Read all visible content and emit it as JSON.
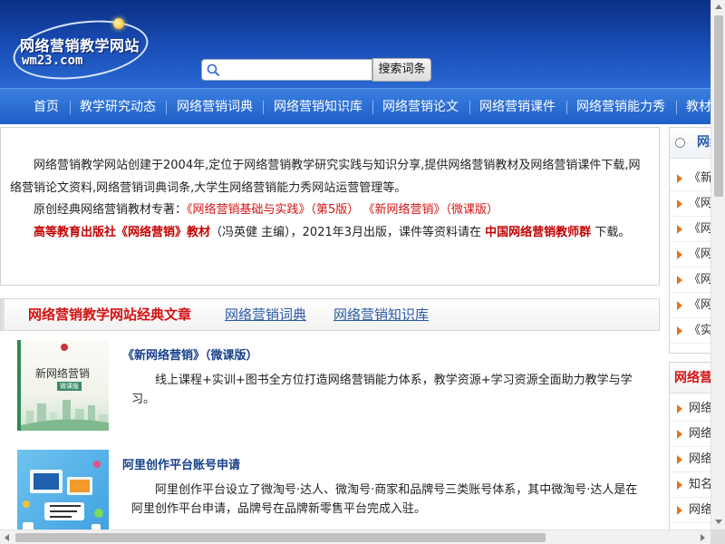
{
  "header": {
    "logo_cn": "网络营销教学网站",
    "logo_en": "wm23.com",
    "search_placeholder": "",
    "search_button": "搜索词条"
  },
  "nav": {
    "items": [
      {
        "label": "首页"
      },
      {
        "label": "教学研究动态"
      },
      {
        "label": "网络营销词典"
      },
      {
        "label": "网络营销知识库"
      },
      {
        "label": "网络营销论文"
      },
      {
        "label": "网络营销课件"
      },
      {
        "label": "网络营销能力秀"
      },
      {
        "label": "教材"
      }
    ]
  },
  "intro": {
    "p1": "网络营销教学网站创建于2004年,定位于网络营销教学研究实践与知识分享,提供网络营销教材及网络营销课件下载,网络营销论文资料,网络营销词典词条,大学生网络营销能力秀网站运营管理等。",
    "p2_prefix": "原创经典网络营销教材专著：",
    "p2_book1": "《网络营销基础与实践》（第5版）",
    "p2_book2": "《新网络营销》（微课版）",
    "p3_publisher": "高等教育出版社《网络营销》教材",
    "p3_mid": "（冯英健 主编），2021年3月出版，课件等资料请在",
    "p3_group": "中国网络营销教师群",
    "p3_end": "下载。"
  },
  "section": {
    "title": "网络营销教学网站经典文章",
    "link1": "网络营销词典",
    "link2": "网络营销知识库"
  },
  "articles": [
    {
      "title": "《新网络营销》（微课版）",
      "desc": "线上课程+实训+图书全方位打造网络营销能力体系，教学资源+学习资源全面助力教学与学习。",
      "thumb_title": "新网络营销",
      "thumb_sub": "微课版"
    },
    {
      "title": "阿里创作平台账号申请",
      "desc": "阿里创作平台设立了微淘号·达人、微淘号·商家和品牌号三类账号体系，其中微淘号·达人是在阿里创作平台申请，品牌号在品牌新零售平台完成入驻。"
    }
  ],
  "right": {
    "box1_head": "网络",
    "box1_items": [
      "《新",
      "《网",
      "《网",
      "《网",
      "《网",
      "《网",
      "《实"
    ],
    "box2_head": "网络营",
    "box2_items": [
      "网络",
      "网络",
      "网络",
      "知名",
      "网络"
    ]
  },
  "colors": {
    "header_blue": "#1a4fb8",
    "nav_blue": "#2a6ad4",
    "accent_red": "#d41212",
    "link_blue": "#2a5aa6",
    "arrow_orange": "#e8731a"
  }
}
